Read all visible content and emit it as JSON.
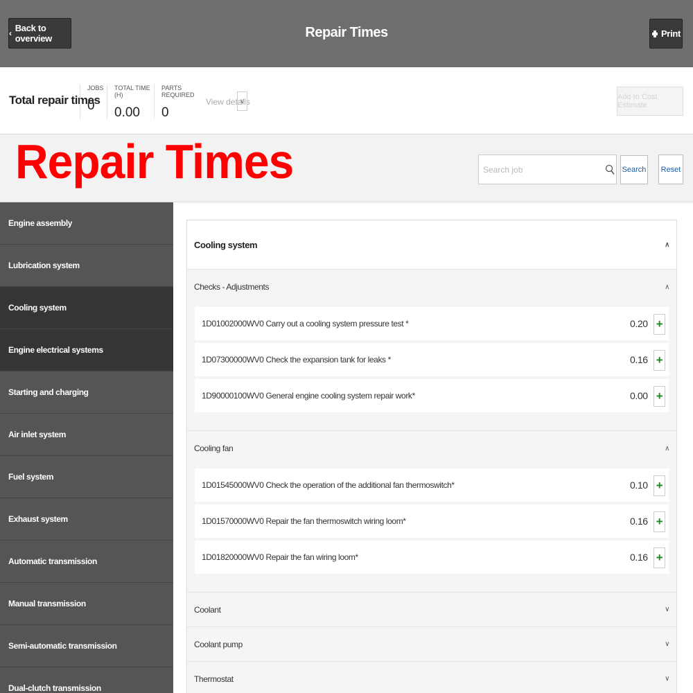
{
  "header": {
    "back_label": "Back to overview",
    "title": "Repair Times",
    "print_label": "Print",
    "back_icon": "chevron-left-icon",
    "print_icon": "printer-icon"
  },
  "summary": {
    "title": "Total repair times",
    "jobs_label": "JOBS",
    "jobs_value": "0",
    "total_time_label": "TOTAL TIME (H)",
    "total_time_value": "0.00",
    "parts_label": "PARTS REQUIRED",
    "parts_value": "0",
    "view_details": "View details",
    "add_to_estimate": "Add to Cost Estimate"
  },
  "overlay_label": "Repair Times",
  "search": {
    "placeholder": "Search job",
    "search_label": "Search",
    "reset_label": "Reset"
  },
  "sidebar": {
    "items": [
      {
        "label": "Engine assembly"
      },
      {
        "label": "Lubrication system"
      },
      {
        "label": "Cooling system"
      },
      {
        "label": "Engine electrical systems"
      },
      {
        "label": "Starting and charging"
      },
      {
        "label": "Air inlet system"
      },
      {
        "label": "Fuel system"
      },
      {
        "label": "Exhaust system"
      },
      {
        "label": "Automatic transmission"
      },
      {
        "label": "Manual transmission"
      },
      {
        "label": "Semi-automatic transmission"
      },
      {
        "label": "Dual-clutch transmission"
      }
    ]
  },
  "panel": {
    "title": "Cooling system",
    "groups": [
      {
        "title": "Checks - Adjustments",
        "jobs": [
          {
            "label": "1D01002000WV0 Carry out a cooling system pressure test *",
            "time": "0.20"
          },
          {
            "label": "1D07300000WV0 Check the expansion tank for leaks *",
            "time": "0.16"
          },
          {
            "label": "1D90000100WV0 General engine cooling system repair work*",
            "time": "0.00"
          }
        ]
      },
      {
        "title": "Cooling fan",
        "jobs": [
          {
            "label": "1D01545000WV0 Check the operation of the additional fan thermoswitch*",
            "time": "0.10"
          },
          {
            "label": "1D01570000WV0 Repair the fan thermoswitch wiring loom*",
            "time": "0.16"
          },
          {
            "label": "1D01820000WV0 Repair the fan wiring loom*",
            "time": "0.16"
          }
        ]
      }
    ],
    "collapsed_groups": [
      {
        "label": "Coolant"
      },
      {
        "label": "Coolant pump"
      },
      {
        "label": "Thermostat"
      }
    ]
  },
  "colors": {
    "header_bg": "#6e6e6e",
    "sidebar_bg": "#555555",
    "sidebar_active": "#353535",
    "overlay_red": "#ff0000",
    "plus_green": "#1a8a1a",
    "link_blue": "#1a5fa8"
  }
}
